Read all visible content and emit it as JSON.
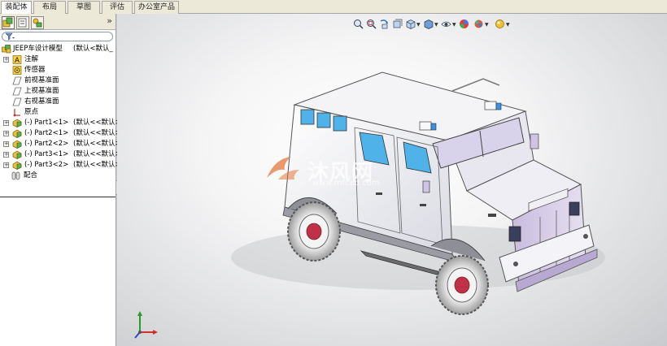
{
  "command_tabs": [
    {
      "label": "装配体",
      "active": true
    },
    {
      "label": "布局",
      "active": false
    },
    {
      "label": "草图",
      "active": false
    },
    {
      "label": "评估",
      "active": false
    },
    {
      "label": "办公室产品",
      "active": false
    }
  ],
  "panel": {
    "tabs": [
      "featuremanager-icon",
      "propertymanager-icon",
      "configurationmanager-icon"
    ],
    "expand_glyph": "»",
    "filter_icon": "filter-icon"
  },
  "tree": {
    "root": {
      "label": "JEEP车设计模型",
      "config": "(默认<默认_"
    },
    "items": [
      {
        "label": "注解",
        "icon": "annotations-icon",
        "expandable": true
      },
      {
        "label": "传感器",
        "icon": "sensors-icon",
        "expandable": false
      },
      {
        "label": "前视基准面",
        "icon": "plane-icon",
        "expandable": false
      },
      {
        "label": "上视基准面",
        "icon": "plane-icon",
        "expandable": false
      },
      {
        "label": "右视基准面",
        "icon": "plane-icon",
        "expandable": false
      },
      {
        "label": "原点",
        "icon": "origin-icon",
        "expandable": false
      }
    ],
    "parts": [
      {
        "label": "(-) Part1<1>",
        "config": "(默认<<默认>_"
      },
      {
        "label": "(-) Part2<1>",
        "config": "(默认<<默认>_"
      },
      {
        "label": "(-) Part2<2>",
        "config": "(默认<<默认>_"
      },
      {
        "label": "(-) Part3<1>",
        "config": "(默认<<默认>_"
      },
      {
        "label": "(-) Part3<2>",
        "config": "(默认<<默认>_"
      }
    ],
    "mates": {
      "label": "配合",
      "icon": "mates-icon"
    }
  },
  "view_toolbar": [
    "zoom-to-fit-icon",
    "zoom-to-area-icon",
    "previous-view-icon",
    "section-view-icon",
    "view-orientation-icon",
    "display-style-icon",
    "hide-show-items-icon",
    "edit-appearance-icon",
    "apply-scene-icon",
    "view-settings-icon"
  ],
  "watermark": {
    "text": "沐风网",
    "url": "www.mfcad.com"
  },
  "colors": {
    "accent": "#d07a20",
    "selection": "#316ac5",
    "body_panel": "#f2f2f4",
    "window_glass": "#4fb2e8",
    "lavender": "#c6b8dc"
  }
}
